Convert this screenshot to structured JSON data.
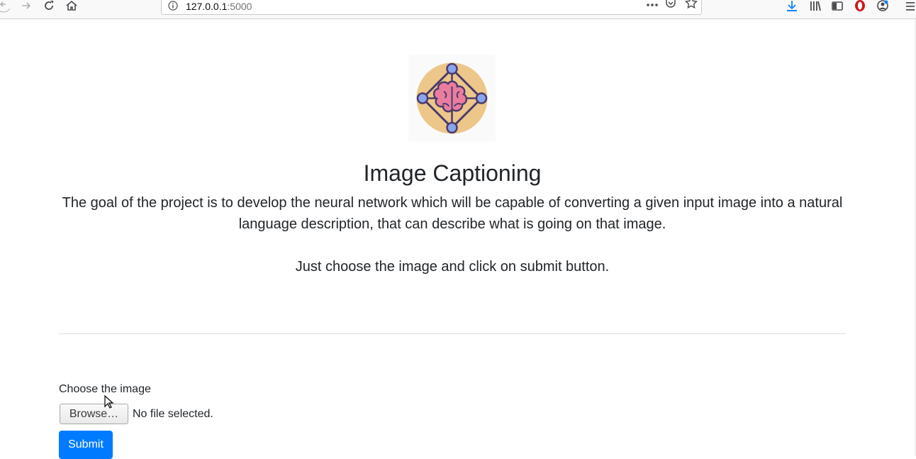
{
  "browser": {
    "url_host": "127.0.0.1",
    "url_port": ":5000",
    "icons": [
      "back-icon",
      "forward-icon",
      "reload-icon",
      "home-icon",
      "site-info-icon",
      "page-actions-icon",
      "pocket-icon",
      "bookmark-star-icon",
      "downloads-icon",
      "library-icon",
      "sidebar-icon",
      "opera-icon",
      "account-icon",
      "menu-icon"
    ],
    "accent_color": "#0a84ff"
  },
  "page": {
    "title": "Image Captioning",
    "description": "The goal of the project is to develop the neural network which will be capable of converting a given input image into a natural language description, that can describe what is going on that image.",
    "instruction": "Just choose the image and click on submit button.",
    "logo_icon": "brain-network-icon"
  },
  "form": {
    "file_label": "Choose the image",
    "browse_label": "Browse…",
    "file_status": "No file selected.",
    "submit_label": "Submit",
    "submit_color": "#007bff"
  }
}
